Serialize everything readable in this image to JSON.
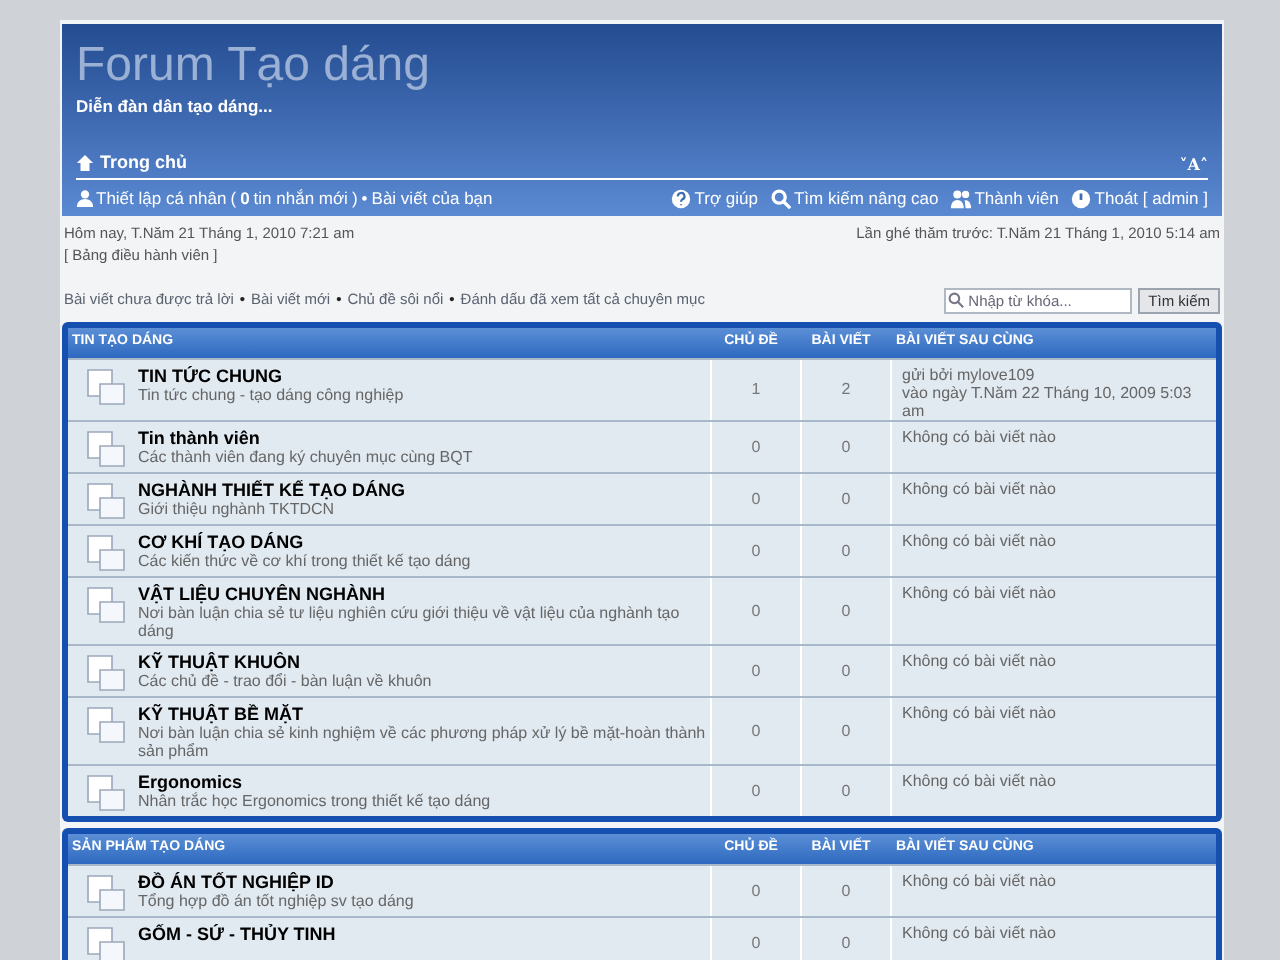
{
  "header": {
    "title": "Forum Tạo dáng",
    "tagline": "Diễn đàn dân tạo dáng...",
    "home": "Trong chủ",
    "font_toggle": "˅A˄"
  },
  "navbar": {
    "left": [
      {
        "kind": "link",
        "text": "Thiết lập cá nhân"
      },
      {
        "kind": "plain",
        "text": "("
      },
      {
        "kind": "bold",
        "text": "0"
      },
      {
        "kind": "link",
        "text": "tin nhắn mới"
      },
      {
        "kind": "plain",
        "text": ")"
      },
      {
        "kind": "plain",
        "text": "•"
      },
      {
        "kind": "link",
        "text": "Bài viết của bạn"
      }
    ],
    "right": [
      {
        "kind": "help",
        "text": "Trợ giúp"
      },
      {
        "kind": "search",
        "text": "Tìm kiếm nâng cao"
      },
      {
        "kind": "members",
        "text": "Thành viên"
      },
      {
        "kind": "logout",
        "text": "Thoát [ admin ]"
      }
    ]
  },
  "info": {
    "today": "Hôm nay, T.Năm 21 Tháng 1, 2010 7:21 am",
    "last_visit": "Lần ghé thăm trước: T.Năm 21 Tháng 1, 2010 5:14 am",
    "mcp": "[ Bảng điều hành viên ]"
  },
  "quick_links": [
    {
      "kind": "link",
      "text": "Bài viết chưa được trả lời"
    },
    {
      "kind": "separator",
      "text": "•"
    },
    {
      "kind": "link",
      "text": "Bài viết mới"
    },
    {
      "kind": "separator",
      "text": "•"
    },
    {
      "kind": "link",
      "text": "Chủ đề sôi nổi"
    },
    {
      "kind": "separator",
      "text": "•"
    },
    {
      "kind": "link",
      "text": "Đánh dấu đã xem tất cả chuyên mục"
    }
  ],
  "search": {
    "placeholder": "Nhập từ khóa...",
    "button": "Tìm kiếm"
  },
  "categories": [
    {
      "title": "TIN TẠO DÁNG",
      "columns": [
        "CHỦ ĐỀ",
        "BÀI VIẾT",
        "BÀI VIẾT SAU CÙNG"
      ],
      "forums": [
        {
          "name": "TIN TỨC CHUNG",
          "description": "Tin tức chung - tạo dáng công nghiệp",
          "topics": "1",
          "posts": "2",
          "last_post": [
            "gửi bởi mylove109",
            "vào ngày T.Năm 22 Tháng 10, 2009 5:03 am"
          ]
        },
        {
          "name": "Tin thành viên",
          "description": "Các thành viên đang ký chuyên mục cùng BQT",
          "topics": "0",
          "posts": "0",
          "last_post": [
            "Không có bài viết nào"
          ]
        },
        {
          "name": "NGHÀNH THIẾT KẾ TẠO DÁNG",
          "description": "Giới thiệu nghành TKTDCN",
          "topics": "0",
          "posts": "0",
          "last_post": [
            "Không có bài viết nào"
          ]
        },
        {
          "name": "CƠ KHÍ TẠO DÁNG",
          "description": "Các kiến thức về cơ khí trong thiết kế tạo dáng",
          "topics": "0",
          "posts": "0",
          "last_post": [
            "Không có bài viết nào"
          ]
        },
        {
          "name": "VẬT LIỆU CHUYÊN NGHÀNH",
          "description": "Nơi bàn luận chia sẻ tư liệu nghiên cứu giới thiệu về vật liệu của nghành tạo dáng",
          "topics": "0",
          "posts": "0",
          "last_post": [
            "Không có bài viết nào"
          ]
        },
        {
          "name": "KỸ THUẬT KHUÔN",
          "description": "Các chủ đề - trao đổi - bàn luận về khuôn",
          "topics": "0",
          "posts": "0",
          "last_post": [
            "Không có bài viết nào"
          ]
        },
        {
          "name": "KỸ THUẬT BỀ MẶT",
          "description": "Nơi bàn luận chia sẻ kinh nghiệm về các phương pháp xử lý bề mặt-hoàn thành sản phẩm",
          "topics": "0",
          "posts": "0",
          "last_post": [
            "Không có bài viết nào"
          ]
        },
        {
          "name": "Ergonomics",
          "description": "Nhân trắc học Ergonomics trong thiết kế tạo dáng",
          "topics": "0",
          "posts": "0",
          "last_post": [
            "Không có bài viết nào"
          ]
        }
      ]
    },
    {
      "title": "SẢN PHẨM TẠO DÁNG",
      "columns": [
        "CHỦ ĐỀ",
        "BÀI VIẾT",
        "BÀI VIẾT SAU CÙNG"
      ],
      "forums": [
        {
          "name": "ĐỒ ÁN TỐT NGHIỆP ID",
          "description": "Tổng hợp đồ án tốt nghiệp sv tạo dáng",
          "topics": "0",
          "posts": "0",
          "last_post": [
            "Không có bài viết nào"
          ]
        },
        {
          "name": "GỐM - SỨ - THỦY TINH",
          "topics": "0",
          "posts": "0",
          "last_post": [
            "Không có bài viết nào"
          ]
        }
      ]
    }
  ]
}
